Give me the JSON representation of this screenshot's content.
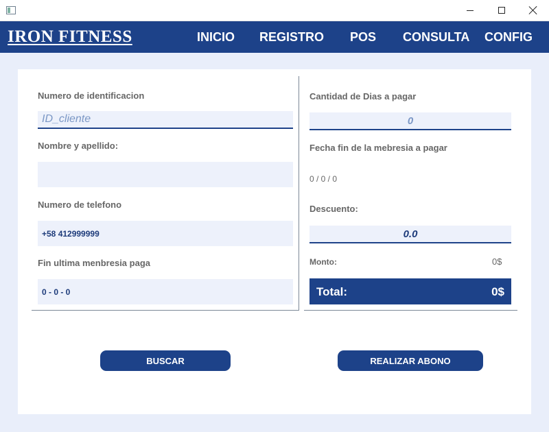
{
  "window": {
    "controls": {
      "minimize": "minimize-icon",
      "maximize": "maximize-icon",
      "close": "close-icon"
    }
  },
  "navbar": {
    "brand": "IRON FITNESS",
    "items": [
      "INICIO",
      "REGISTRO",
      "POS",
      "CONSULTA",
      "CONFIG"
    ]
  },
  "form_left": {
    "id_label": "Numero de identificacion",
    "id_placeholder": "ID_cliente",
    "id_value": "",
    "name_label": "Nombre y apellido:",
    "name_value": "",
    "phone_label": "Numero de telefono",
    "phone_value": "+58 412999999",
    "last_membership_label": "Fin ultima menbresia paga",
    "last_membership_value": "0 - 0 - 0"
  },
  "form_right": {
    "days_label": "Cantidad de Dias a pagar",
    "days_placeholder": "0",
    "end_date_label": "Fecha fin de la mebresia a pagar",
    "end_date_value": "0 / 0 / 0",
    "discount_label": "Descuento:",
    "discount_value": "0.0",
    "amount_label": "Monto:",
    "amount_value": "0$",
    "total_label": "Total:",
    "total_value": "0$"
  },
  "actions": {
    "search": "BUSCAR",
    "pay": "REALIZAR ABONO"
  },
  "colors": {
    "brand_blue": "#1d4289",
    "background": "#e9eefa",
    "field_bg": "#edf1fb",
    "label_gray": "#666666"
  }
}
